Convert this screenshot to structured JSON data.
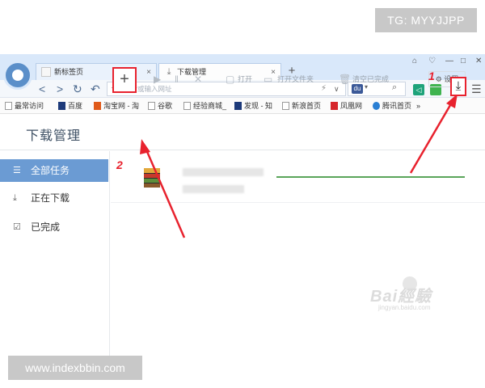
{
  "watermarks": {
    "top": "TG: MYYJJPP",
    "bottom": "www.indexbbin.com",
    "baidu": "Bai經驗",
    "baidu_url": "jingyan.baidu.com"
  },
  "browser": {
    "tabs": [
      {
        "label": "新标签页",
        "close": "×"
      },
      {
        "label": "下载管理",
        "close": "×"
      }
    ],
    "new_tab": "+",
    "window_controls": [
      "⌂",
      "♡",
      "—",
      "□",
      "✕"
    ],
    "nav": {
      "back": "<",
      "forward": ">",
      "refresh": "↻",
      "undo": "↶"
    },
    "address_placeholder": "搜索或输入网址",
    "bookmarks": [
      "最常访问",
      "百度",
      "淘宝网 - 淘",
      "谷歌",
      "经验商城_",
      "发现 - 知",
      "新浪首页",
      "凤凰网",
      "腾讯首页",
      "»"
    ]
  },
  "download_manager": {
    "title": "下载管理",
    "add_label": "+",
    "toolbar": {
      "open": "打开",
      "open_folder": "打开文件夹",
      "clear_done": "清空已完成",
      "settings": "设置"
    },
    "sidebar": [
      {
        "label": "全部任务",
        "icon": "list-icon",
        "active": true
      },
      {
        "label": "正在下载",
        "icon": "download-icon",
        "active": false
      },
      {
        "label": "已完成",
        "icon": "check-box-icon",
        "active": false
      }
    ]
  },
  "annotations": {
    "step1": "1",
    "step2": "2"
  },
  "colors": {
    "accent": "#6b9bd3",
    "highlight": "#e8222e",
    "progress": "#5aa55a"
  }
}
